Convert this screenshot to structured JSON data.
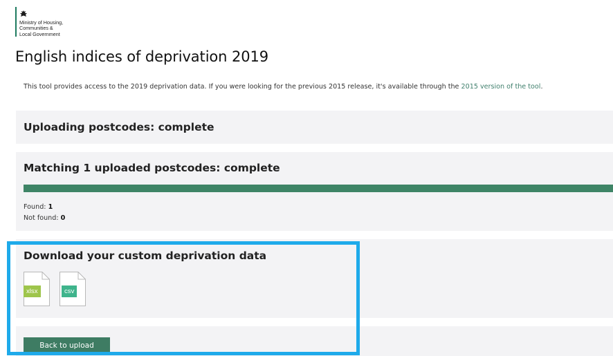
{
  "logo": {
    "icon": "royal-crest-icon",
    "lines": [
      "Ministry of Housing,",
      "Communities &",
      "Local Government"
    ]
  },
  "page": {
    "title": "English indices of deprivation 2019"
  },
  "intro": {
    "text": "This tool provides access to the 2019 deprivation data. If you were looking for the previous 2015 release, it's available through the ",
    "link_label": "2015 version of the tool",
    "suffix": "."
  },
  "upload_panel": {
    "heading": "Uploading postcodes: complete"
  },
  "match_panel": {
    "heading": "Matching 1 uploaded postcodes: complete",
    "progress_fraction": 1.0,
    "found_label": "Found:",
    "found_value": "1",
    "not_found_label": "Not found:",
    "not_found_value": "0"
  },
  "download_panel": {
    "heading": "Download your custom deprivation data",
    "files": [
      {
        "label": "xlsx",
        "icon": "document-xlsx-icon",
        "color": "#9ec54b"
      },
      {
        "label": "csv",
        "icon": "document-csv-icon",
        "color": "#3fb48c"
      }
    ]
  },
  "actions": {
    "back_label": "Back to upload"
  },
  "colors": {
    "accent": "#3e7c63",
    "highlight": "#1eaaea",
    "panel_bg": "#f3f3f5"
  }
}
